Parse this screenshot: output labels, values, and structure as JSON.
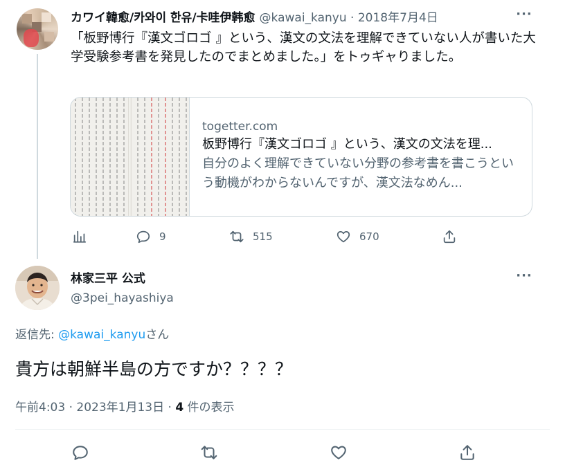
{
  "parent": {
    "name": "カワイ韓愈/카와이 한유/卡哇伊韩愈",
    "handle": "@kawai_kanyu",
    "separator": "·",
    "date": "2018年7月4日",
    "more_label": "···",
    "text": "「板野博行『漢文ゴロゴ 』という、漢文の文法を理解できていない人が書いた大学受験参考書を発見したのでまとめました。」をトゥギャりました。",
    "card": {
      "domain": "togetter.com",
      "title": "板野博行『漢文ゴロゴ 』という、漢文の文法を理...",
      "description": "自分のよく理解できていない分野の参考書を書こうという動機がわからないんですが、漢文法なめん..."
    },
    "actions": {
      "views_icon": "analytics-icon",
      "reply_count": "9",
      "retweet_count": "515",
      "like_count": "670",
      "share_icon": "share-icon"
    }
  },
  "reply": {
    "name": "林家三平 公式",
    "handle": "@3pei_hayashiya",
    "more_label": "···",
    "reply_to_prefix": "返信先: ",
    "reply_to_mention": "@kawai_kanyu",
    "reply_to_suffix": "さん",
    "text": "貴方は朝鮮半島の方ですか？？？？",
    "time": "午前4:03 · 2023年1月13日 · ",
    "views_count": "4",
    "views_label": " 件の表示"
  },
  "colors": {
    "accent": "#1d9bf0",
    "secondary_text": "#536471",
    "border": "#cfd9de"
  }
}
